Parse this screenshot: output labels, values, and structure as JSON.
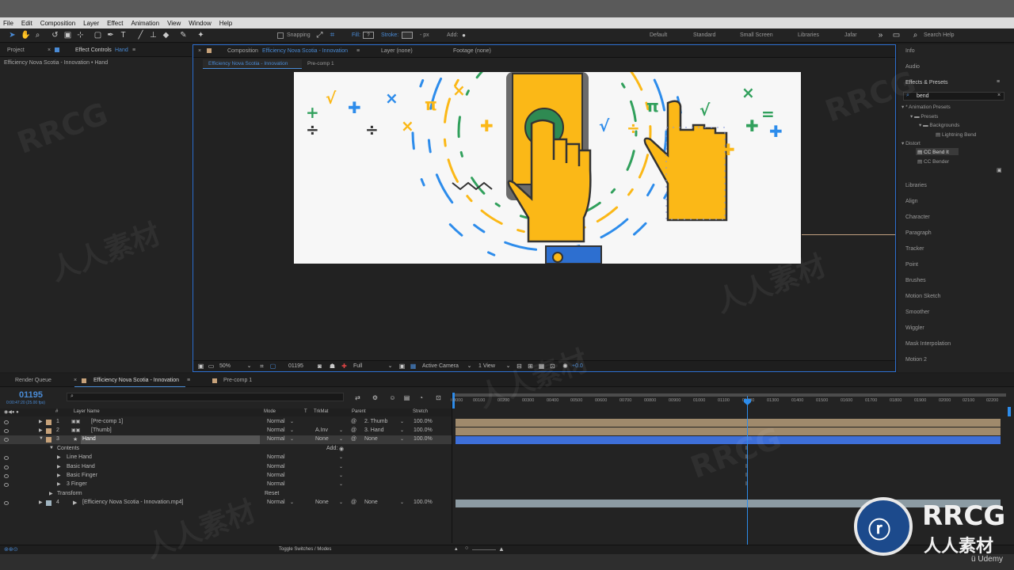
{
  "menu": [
    "File",
    "Edit",
    "Composition",
    "Layer",
    "Effect",
    "Animation",
    "View",
    "Window",
    "Help"
  ],
  "toolbar": {
    "snapping": "Snapping",
    "fill": "Fill:",
    "stroke": "Stroke:",
    "stroke_px": "- px",
    "add": "Add:",
    "workspaces": [
      "Default",
      "Standard",
      "Small Screen",
      "Libraries",
      "Jafar"
    ],
    "search_help": "Search Help"
  },
  "left_panel": {
    "tab_project": "Project",
    "tab_effect_controls": "Effect Controls",
    "tab_effect_controls_layer": "Hand",
    "breadcrumb": "Efficiency Nova Scotia - Innovation • Hand"
  },
  "viewer": {
    "tab_composition": "Composition",
    "tab_composition_name": "Efficiency Nova Scotia - Innovation",
    "tab_layer": "Layer (none)",
    "tab_footage": "Footage (none)",
    "subtab_main": "Efficiency Nova Scotia - Innovation",
    "subtab_precomp": "Pre-comp 1",
    "zoom": "50%",
    "timecode": "01195",
    "resolution": "Full",
    "camera": "Active Camera",
    "views": "1 View",
    "exposure": "+0.0"
  },
  "right_panel": {
    "info": "Info",
    "audio": "Audio",
    "effects_presets": "Effects & Presets",
    "search_value": "bend",
    "tree": [
      {
        "label": "* Animation Presets",
        "level": 0
      },
      {
        "label": "Presets",
        "level": 1
      },
      {
        "label": "Backgrounds",
        "level": 2
      },
      {
        "label": "Lightning Bend",
        "level": 3
      },
      {
        "label": "Distort",
        "level": 0
      },
      {
        "label": "CC Bend It",
        "level": 1
      },
      {
        "label": "CC Bender",
        "level": 1
      }
    ],
    "panels": [
      "Libraries",
      "Align",
      "Character",
      "Paragraph",
      "Tracker",
      "Point",
      "Brushes",
      "Motion Sketch",
      "Smoother",
      "Wiggler",
      "Mask Interpolation",
      "Motion 2"
    ]
  },
  "timeline": {
    "tab_render_queue": "Render Queue",
    "tab_comp": "Efficiency Nova Scotia - Innovation",
    "tab_precomp": "Pre-comp 1",
    "current_time": "01195",
    "time_sub": "0:00:47:20 (25.00 fps)",
    "search_placeholder": "⌕",
    "columns": {
      "num": "#",
      "layer_name": "Layer Name",
      "mode": "Mode",
      "t": "T",
      "trkmat": "TrkMat",
      "parent": "Parent",
      "stretch": "Stretch"
    },
    "ruler": [
      "00000",
      "00100",
      "00200",
      "00300",
      "00400",
      "00500",
      "00600",
      "00700",
      "00800",
      "00900",
      "01000",
      "01100",
      "01200",
      "01300",
      "01400",
      "01500",
      "01600",
      "01700",
      "01800",
      "01900",
      "02000",
      "02100",
      "02200"
    ],
    "layers": [
      {
        "num": "1",
        "name": "[Pre-comp 1]",
        "mode": "Normal",
        "trkmat": "",
        "parent": "2. Thumb",
        "stretch": "100.0%",
        "color": "#c7a27a"
      },
      {
        "num": "2",
        "name": "[Thumb]",
        "mode": "Normal",
        "trkmat": "A.Inv",
        "parent": "3. Hand",
        "stretch": "100.0%",
        "color": "#c7a27a"
      },
      {
        "num": "3",
        "name": "Hand",
        "mode": "Normal",
        "trkmat": "None",
        "parent": "None",
        "stretch": "100.0%",
        "color": "#c7a27a"
      },
      {
        "num": "4",
        "name": "[Efficiency Nova Scotia - Innovation.mp4]",
        "mode": "Normal",
        "trkmat": "None",
        "parent": "None",
        "stretch": "100.0%",
        "color": "#a0b4c0"
      }
    ],
    "contents_label": "Contents",
    "add_label": "Add:",
    "contents": [
      {
        "name": "Line Hand",
        "mode": "Normal"
      },
      {
        "name": "Basic Hand",
        "mode": "Normal"
      },
      {
        "name": "Basic Finger",
        "mode": "Normal"
      },
      {
        "name": "3 Finger",
        "mode": "Normal"
      }
    ],
    "transform_label": "Transform",
    "reset_label": "Reset",
    "toggle_label": "Toggle Switches / Modes"
  },
  "watermark": {
    "brand": "RRCG",
    "sub": "人人素材",
    "udemy": "Udemy",
    "wm_text": "RRCG",
    "wm_cn": "人人素材"
  },
  "colors": {
    "accent": "#2d8ceb",
    "hand": "#fbb817",
    "layer_tan": "#c7a27a",
    "selected_bar": "#3e6fd8"
  }
}
